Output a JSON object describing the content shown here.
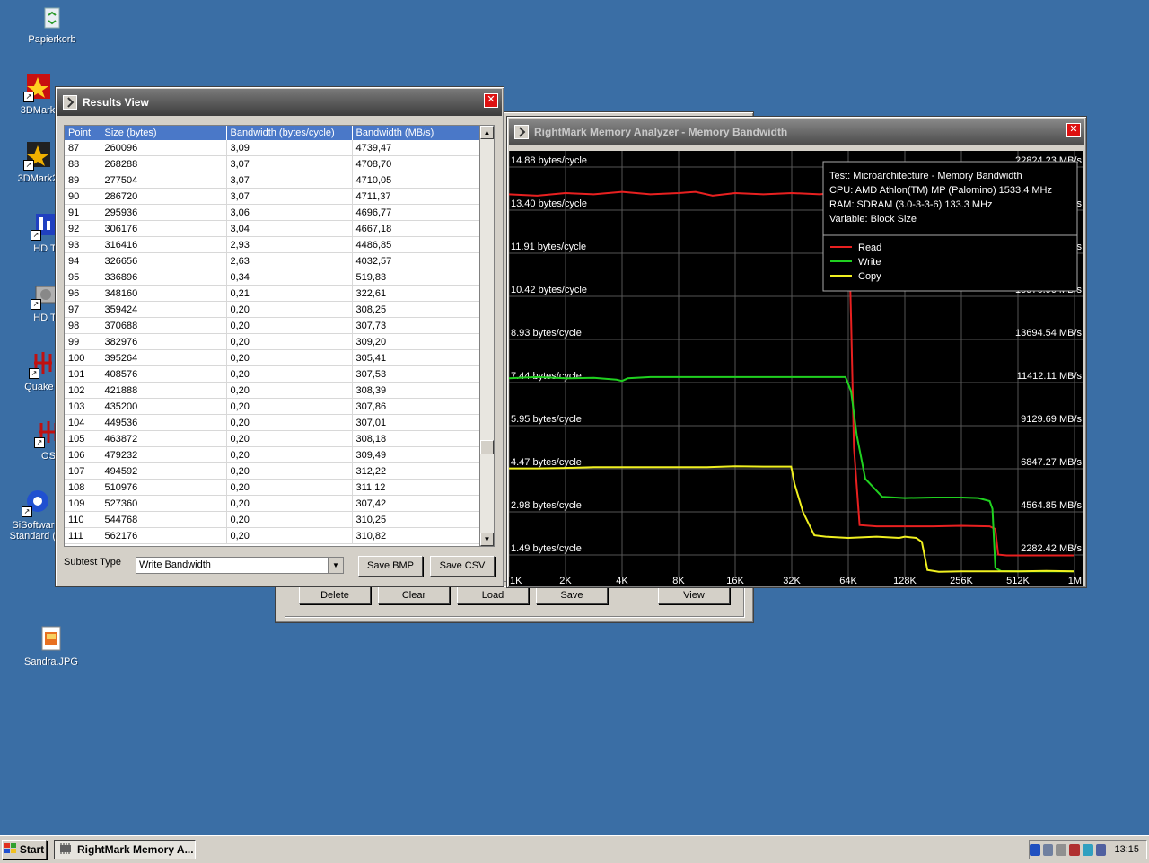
{
  "desktop": {
    "icons": [
      {
        "label": "Papierkorb"
      },
      {
        "label": "3DMark"
      },
      {
        "label": "3DMark2"
      },
      {
        "label": "HD T"
      },
      {
        "label": "HD T"
      },
      {
        "label": "Quake II"
      },
      {
        "label": "OS"
      },
      {
        "label": "SiSoftware Standard (V"
      },
      {
        "label": "Sandra.JPG"
      }
    ]
  },
  "results_window": {
    "title": "Results View",
    "columns": [
      "Point",
      "Size (bytes)",
      "Bandwidth (bytes/cycle)",
      "Bandwidth (MB/s)"
    ],
    "rows": [
      [
        "87",
        "260096",
        "3,09",
        "4739,47"
      ],
      [
        "88",
        "268288",
        "3,07",
        "4708,70"
      ],
      [
        "89",
        "277504",
        "3,07",
        "4710,05"
      ],
      [
        "90",
        "286720",
        "3,07",
        "4711,37"
      ],
      [
        "91",
        "295936",
        "3,06",
        "4696,77"
      ],
      [
        "92",
        "306176",
        "3,04",
        "4667,18"
      ],
      [
        "93",
        "316416",
        "2,93",
        "4486,85"
      ],
      [
        "94",
        "326656",
        "2,63",
        "4032,57"
      ],
      [
        "95",
        "336896",
        "0,34",
        "519,83"
      ],
      [
        "96",
        "348160",
        "0,21",
        "322,61"
      ],
      [
        "97",
        "359424",
        "0,20",
        "308,25"
      ],
      [
        "98",
        "370688",
        "0,20",
        "307,73"
      ],
      [
        "99",
        "382976",
        "0,20",
        "309,20"
      ],
      [
        "100",
        "395264",
        "0,20",
        "305,41"
      ],
      [
        "101",
        "408576",
        "0,20",
        "307,53"
      ],
      [
        "102",
        "421888",
        "0,20",
        "308,39"
      ],
      [
        "103",
        "435200",
        "0,20",
        "307,86"
      ],
      [
        "104",
        "449536",
        "0,20",
        "307,01"
      ],
      [
        "105",
        "463872",
        "0,20",
        "308,18"
      ],
      [
        "106",
        "479232",
        "0,20",
        "309,49"
      ],
      [
        "107",
        "494592",
        "0,20",
        "312,22"
      ],
      [
        "108",
        "510976",
        "0,20",
        "311,12"
      ],
      [
        "109",
        "527360",
        "0,20",
        "307,42"
      ],
      [
        "110",
        "544768",
        "0,20",
        "310,25"
      ],
      [
        "111",
        "562176",
        "0,20",
        "310,82"
      ]
    ],
    "subtest_label": "Subtest Type",
    "subtest_value": "Write Bandwidth",
    "save_bmp": "Save BMP",
    "save_csv": "Save CSV"
  },
  "main_window": {
    "buttons": {
      "delete": "Delete",
      "clear": "Clear",
      "load": "Load",
      "save": "Save",
      "view": "View"
    }
  },
  "graph_window": {
    "title": "RightMark Memory Analyzer - Memory Bandwidth",
    "info": [
      "Test: Microarchitecture - Memory Bandwidth",
      "CPU: AMD Athlon(TM) MP (Palomino) 1533.4 MHz",
      "RAM: SDRAM (3.0-3-3-6) 133.3 MHz",
      "Variable: Block Size"
    ],
    "legend": [
      {
        "name": "Read",
        "color": "#e82020"
      },
      {
        "name": "Write",
        "color": "#20d020"
      },
      {
        "name": "Copy",
        "color": "#f0f020"
      }
    ]
  },
  "chart_data": {
    "type": "line",
    "x_ticks": [
      "1K",
      "2K",
      "4K",
      "8K",
      "16K",
      "32K",
      "64K",
      "128K",
      "256K",
      "512K",
      "1M"
    ],
    "y_left_ticks": [
      "14.88 bytes/cycle",
      "13.40 bytes/cycle",
      "11.91 bytes/cycle",
      "10.42 bytes/cycle",
      "8.93 bytes/cycle",
      "7.44 bytes/cycle",
      "5.95 bytes/cycle",
      "4.47 bytes/cycle",
      "2.98 bytes/cycle",
      "1.49 bytes/cycle"
    ],
    "y_right_ticks": [
      "22824.23 MB/s",
      "20541.81 MB/s",
      "18259.38 MB/s",
      "15976.96 MB/s",
      "13694.54 MB/s",
      "11412.11 MB/s",
      "9129.69 MB/s",
      "6847.27 MB/s",
      "4564.85 MB/s",
      "2282.42 MB/s"
    ],
    "ylim": [
      0,
      16.4
    ],
    "grid": true,
    "legend_position": "top-right",
    "series": [
      {
        "name": "Read",
        "color": "#e82020",
        "points": [
          [
            0,
            14.85
          ],
          [
            0.5,
            14.8
          ],
          [
            1,
            14.9
          ],
          [
            1.5,
            14.85
          ],
          [
            2,
            14.95
          ],
          [
            2.5,
            14.85
          ],
          [
            3,
            14.9
          ],
          [
            3.3,
            14.95
          ],
          [
            3.6,
            14.8
          ],
          [
            4,
            14.9
          ],
          [
            4.5,
            14.85
          ],
          [
            5,
            14.9
          ],
          [
            5.5,
            14.85
          ],
          [
            5.9,
            14.95
          ],
          [
            6.0,
            14.3
          ],
          [
            6.05,
            10
          ],
          [
            6.1,
            5
          ],
          [
            6.2,
            2.0
          ],
          [
            6.5,
            1.95
          ],
          [
            7,
            1.95
          ],
          [
            7.5,
            1.95
          ],
          [
            8,
            1.97
          ],
          [
            8.5,
            1.95
          ],
          [
            8.6,
            1.85
          ],
          [
            8.65,
            0.85
          ],
          [
            8.8,
            0.82
          ],
          [
            9,
            0.82
          ],
          [
            9.5,
            0.82
          ],
          [
            10,
            0.82
          ]
        ]
      },
      {
        "name": "Write",
        "color": "#20d020",
        "points": [
          [
            0,
            7.7
          ],
          [
            0.5,
            7.75
          ],
          [
            1,
            7.7
          ],
          [
            1.5,
            7.72
          ],
          [
            1.9,
            7.65
          ],
          [
            2,
            7.6
          ],
          [
            2.1,
            7.7
          ],
          [
            2.5,
            7.75
          ],
          [
            3,
            7.75
          ],
          [
            3.5,
            7.75
          ],
          [
            4,
            7.75
          ],
          [
            4.5,
            7.75
          ],
          [
            5,
            7.75
          ],
          [
            5.5,
            7.75
          ],
          [
            5.95,
            7.75
          ],
          [
            6.05,
            7.2
          ],
          [
            6.15,
            5.5
          ],
          [
            6.3,
            3.8
          ],
          [
            6.6,
            3.1
          ],
          [
            7,
            3.05
          ],
          [
            7.5,
            3.07
          ],
          [
            8,
            3.07
          ],
          [
            8.3,
            3.05
          ],
          [
            8.5,
            2.93
          ],
          [
            8.55,
            2.63
          ],
          [
            8.6,
            0.34
          ],
          [
            8.7,
            0.21
          ],
          [
            9,
            0.2
          ],
          [
            9.5,
            0.2
          ],
          [
            10,
            0.2
          ]
        ]
      },
      {
        "name": "Copy",
        "color": "#f0f020",
        "points": [
          [
            0,
            4.2
          ],
          [
            0.5,
            4.2
          ],
          [
            1,
            4.22
          ],
          [
            1.5,
            4.25
          ],
          [
            2,
            4.25
          ],
          [
            2.5,
            4.25
          ],
          [
            3,
            4.25
          ],
          [
            3.5,
            4.25
          ],
          [
            4,
            4.28
          ],
          [
            4.5,
            4.27
          ],
          [
            4.99,
            4.27
          ],
          [
            5.05,
            3.6
          ],
          [
            5.2,
            2.5
          ],
          [
            5.4,
            1.6
          ],
          [
            5.6,
            1.55
          ],
          [
            6,
            1.5
          ],
          [
            6.5,
            1.55
          ],
          [
            6.9,
            1.5
          ],
          [
            7,
            1.55
          ],
          [
            7.2,
            1.5
          ],
          [
            7.3,
            1.35
          ],
          [
            7.4,
            0.25
          ],
          [
            7.6,
            0.18
          ],
          [
            8,
            0.2
          ],
          [
            8.5,
            0.2
          ],
          [
            9,
            0.2
          ],
          [
            9.5,
            0.22
          ],
          [
            10,
            0.2
          ]
        ]
      }
    ]
  },
  "taskbar": {
    "start": "Start",
    "task_item": "RightMark Memory A...",
    "clock": "13:15"
  }
}
